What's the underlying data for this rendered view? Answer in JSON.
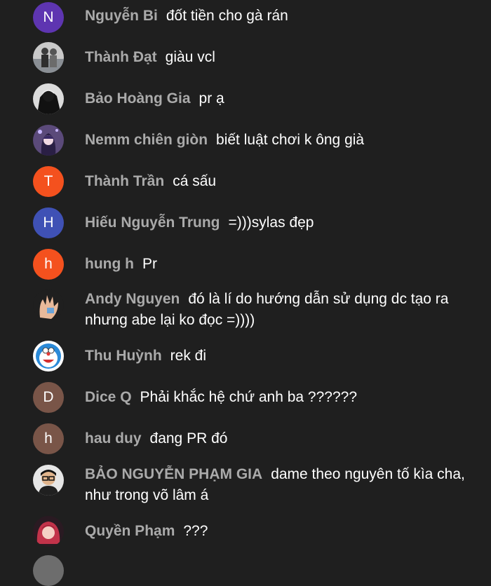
{
  "colors": {
    "background": "#1f1f1f",
    "author": "#aaaaaa",
    "message": "#ffffff",
    "avatar_purple": "#5e35b1",
    "avatar_orange": "#f4511e",
    "avatar_indigo": "#3f51b5",
    "avatar_brown": "#795548"
  },
  "messages": [
    {
      "author": "Nguyễn Bi",
      "text": "đốt tiền cho gà rán",
      "avatar_letter": "N",
      "avatar_icon": "letter-avatar"
    },
    {
      "author": "Thành Đạt",
      "text": "giàu vcl",
      "avatar_icon": "photo-avatar-people"
    },
    {
      "author": "Bảo Hoàng Gia",
      "text": "pr ạ",
      "avatar_icon": "photo-avatar-dark"
    },
    {
      "author": "Nemm chiên giòn",
      "text": "biết luật chơi k ông già",
      "avatar_icon": "photo-avatar-anime"
    },
    {
      "author": "Thành Trần",
      "text": "cá sấu",
      "avatar_letter": "T",
      "avatar_icon": "letter-avatar"
    },
    {
      "author": "Hiếu Nguyễn Trung",
      "text": "=)))sylas đẹp",
      "avatar_letter": "H",
      "avatar_icon": "letter-avatar"
    },
    {
      "author": "hung h",
      "text": "Pr",
      "avatar_letter": "h",
      "avatar_icon": "letter-avatar"
    },
    {
      "author": "Andy Nguyen",
      "text": "đó là lí do hướng dẫn sử dụng dc tạo ra nhưng abe lại ko đọc =))))",
      "avatar_icon": "photo-avatar-hand"
    },
    {
      "author": "Thu Huỳnh",
      "text": "rek đi",
      "avatar_icon": "photo-avatar-doraemon"
    },
    {
      "author": "Dice Q",
      "text": "Phải khắc hệ chứ anh ba ??????",
      "avatar_letter": "D",
      "avatar_icon": "letter-avatar"
    },
    {
      "author": "hau duy",
      "text": "đang PR đó",
      "avatar_letter": "h",
      "avatar_icon": "letter-avatar"
    },
    {
      "author": "BẢO NGUYỄN PHẠM GIA",
      "text": "dame theo nguyên tố kìa cha, như trong võ lâm á",
      "avatar_icon": "photo-avatar-glasses"
    },
    {
      "author": "Quyền Phạm",
      "text": "???",
      "avatar_icon": "photo-avatar-red-hair"
    }
  ]
}
